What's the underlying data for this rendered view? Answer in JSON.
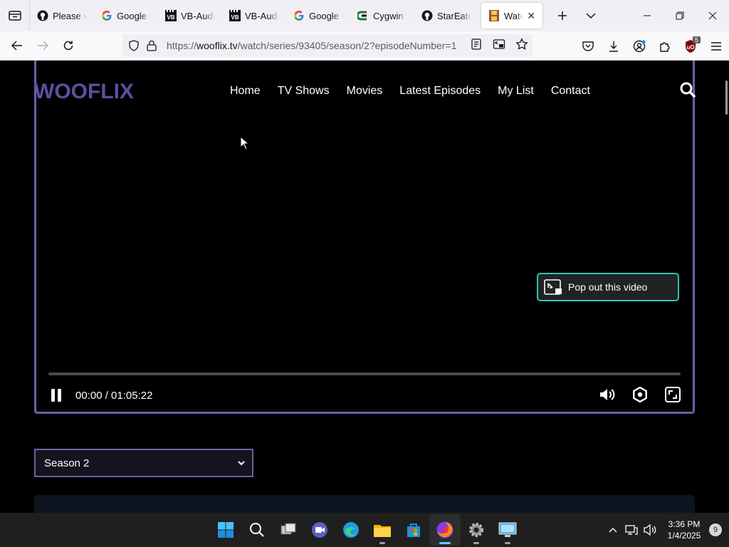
{
  "browser": {
    "tabs": [
      {
        "title": "Please vi",
        "icon": "github-icon"
      },
      {
        "title": "Google I",
        "icon": "google-icon"
      },
      {
        "title": "VB-Audi",
        "icon": "vb-audio-icon"
      },
      {
        "title": "VB-Audi",
        "icon": "vb-audio-icon"
      },
      {
        "title": "Google I",
        "icon": "google-icon"
      },
      {
        "title": "Cygwin",
        "icon": "cygwin-icon"
      },
      {
        "title": "StarEate",
        "icon": "github-icon"
      },
      {
        "title": "Watch",
        "icon": "film-icon",
        "active": true
      }
    ],
    "url_prefix": "https://",
    "url_host": "wooflix.tv",
    "url_path": "/watch/series/93405/season/2?episodeNumber=1",
    "extension_badge": "5"
  },
  "site": {
    "logo": "WOOFLIX",
    "menu": [
      "Home",
      "TV Shows",
      "Movies",
      "Latest Episodes",
      "My List",
      "Contact"
    ]
  },
  "player": {
    "popout_label": "Pop out this video",
    "current_time": "00:00",
    "duration": "01:05:22",
    "time_display": "00:00 / 01:05:22",
    "progress": 0,
    "state": "playing"
  },
  "season_select": {
    "selected": "Season 2"
  },
  "taskbar": {
    "time": "3:36 PM",
    "date": "1/4/2025",
    "notification_count": "9"
  },
  "colors": {
    "accent_purple": "#6d5fa6",
    "logo_purple": "#5f4ea0",
    "popout_border": "#2fc4b2",
    "page_bg": "#000000"
  }
}
